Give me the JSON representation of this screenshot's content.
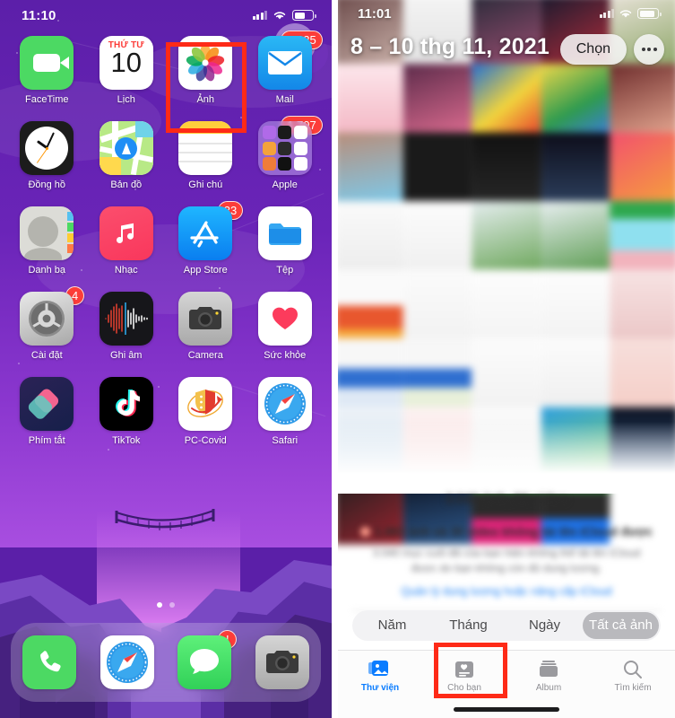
{
  "left_phone": {
    "status_bar": {
      "time": "11:10",
      "signal_icon": "cellular-signal-icon",
      "wifi_icon": "wifi-icon",
      "battery_icon": "battery-icon"
    },
    "apps": [
      {
        "label": "FaceTime",
        "icon": "facetime-icon",
        "badge": null
      },
      {
        "label": "Lịch",
        "icon": "calendar-icon",
        "badge": null,
        "day_of_week": "THỨ TƯ",
        "day_number": "10"
      },
      {
        "label": "Ảnh",
        "icon": "photos-icon",
        "badge": null
      },
      {
        "label": "Mail",
        "icon": "mail-icon",
        "badge": "5.325"
      },
      {
        "label": "Đồng hồ",
        "icon": "clock-icon",
        "badge": null
      },
      {
        "label": "Bản đồ",
        "icon": "maps-icon",
        "badge": null
      },
      {
        "label": "Ghi chú",
        "icon": "notes-icon",
        "badge": null
      },
      {
        "label": "Apple",
        "icon": "folder-icon",
        "badge": "1.707"
      },
      {
        "label": "Danh bạ",
        "icon": "contacts-icon",
        "badge": null
      },
      {
        "label": "Nhạc",
        "icon": "music-icon",
        "badge": null
      },
      {
        "label": "App Store",
        "icon": "app-store-icon",
        "badge": "33"
      },
      {
        "label": "Tệp",
        "icon": "files-icon",
        "badge": null
      },
      {
        "label": "Cài đặt",
        "icon": "settings-gear-icon",
        "badge": "4"
      },
      {
        "label": "Ghi âm",
        "icon": "voice-memos-icon",
        "badge": null
      },
      {
        "label": "Camera",
        "icon": "camera-icon",
        "badge": null
      },
      {
        "label": "Sức khỏe",
        "icon": "health-heart-icon",
        "badge": null
      },
      {
        "label": "Phím tắt",
        "icon": "shortcuts-icon",
        "badge": null
      },
      {
        "label": "TikTok",
        "icon": "tiktok-icon",
        "badge": null
      },
      {
        "label": "PC-Covid",
        "icon": "pccovid-shield-icon",
        "badge": null
      },
      {
        "label": "Safari",
        "icon": "safari-compass-icon",
        "badge": null
      }
    ],
    "dock": [
      {
        "label": "Phone",
        "icon": "phone-icon",
        "badge": null
      },
      {
        "label": "Safari",
        "icon": "safari-compass-icon",
        "badge": null
      },
      {
        "label": "Messages",
        "icon": "messages-icon",
        "badge": "!"
      },
      {
        "label": "Camera",
        "icon": "camera-icon",
        "badge": null
      }
    ],
    "page_dots": {
      "count": 2,
      "active_index": 0
    },
    "highlight": {
      "target": "Ảnh",
      "color": "#fe2a17"
    }
  },
  "right_phone": {
    "status_bar": {
      "time": "11:01",
      "signal_icon": "cellular-signal-icon",
      "wifi_icon": "wifi-icon",
      "battery_icon": "battery-icon"
    },
    "header": {
      "date_range": "8 – 10 thg 11, 2021",
      "select_button": "Chọn",
      "more_button_icon": "ellipsis-icon"
    },
    "info": {
      "count_line": "3.040 ảnh, 50 video",
      "notice_title": "1.883 ảnh và 30 video không tải lên iCloud được",
      "notice_body": "3.040 mục cuối đã của bạn hiện không thể tải lên iCloud được do bạn không còn đủ dung lượng.",
      "link": "Quản lý dung lượng hoặc nâng cấp iCloud"
    },
    "segmented": {
      "options": [
        "Năm",
        "Tháng",
        "Ngày",
        "Tất cả ảnh"
      ],
      "selected": "Tất cả ảnh"
    },
    "tabs": [
      {
        "label": "Thư viện",
        "icon": "photo-library-icon",
        "active": true
      },
      {
        "label": "Cho bạn",
        "icon": "for-you-icon",
        "active": false
      },
      {
        "label": "Album",
        "icon": "albums-icon",
        "active": false
      },
      {
        "label": "Tìm kiếm",
        "icon": "search-icon",
        "active": false
      }
    ],
    "highlight": {
      "target": "Cho bạn",
      "color": "#fe2a17"
    }
  },
  "colors": {
    "home_bg": "#5b1fa8",
    "accent_blue": "#0a7cff",
    "badge_red": "#fc3d39",
    "highlight_red": "#fe2a17"
  }
}
